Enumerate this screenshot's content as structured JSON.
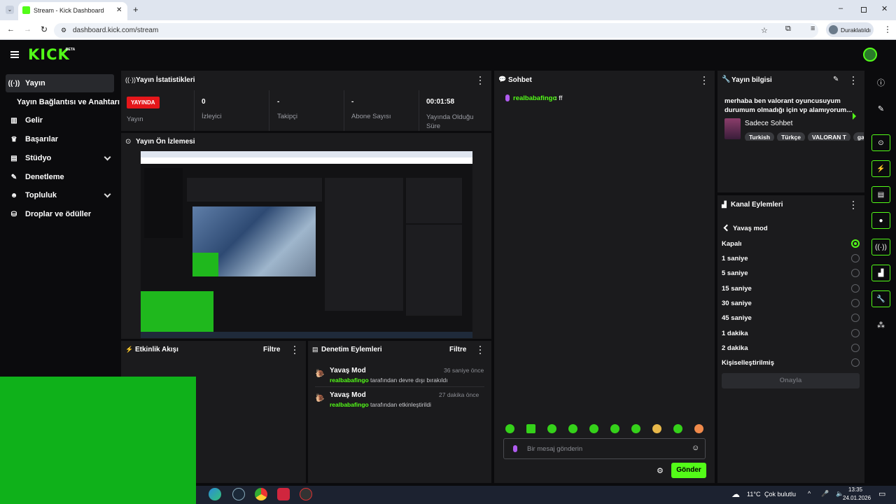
{
  "browser": {
    "tab_title": "Stream - Kick Dashboard",
    "url": "dashboard.kick.com/stream",
    "profile_label": "Duraklatıldı"
  },
  "header": {
    "logo": "KICK",
    "logo_badge": "BETA"
  },
  "sidebar": {
    "items": [
      {
        "label": "Yayın",
        "icon": "broadcast-icon"
      },
      {
        "label": "Yayın Bağlantısı ve Anahtarı"
      },
      {
        "label": "Gelir",
        "icon": "chart-icon"
      },
      {
        "label": "Başarılar",
        "icon": "trophy-icon"
      },
      {
        "label": "Stüdyo",
        "icon": "studio-icon"
      },
      {
        "label": "Denetleme",
        "icon": "wrench-icon"
      },
      {
        "label": "Topluluk",
        "icon": "users-icon"
      },
      {
        "label": "Droplar ve ödüller",
        "icon": "gift-icon"
      }
    ]
  },
  "stats": {
    "title": "Yayın İstatistikleri",
    "live_badge": "YAYINDA",
    "live_label": "Yayın",
    "viewers_value": "0",
    "viewers_label": "İzleyici",
    "followers_value": "-",
    "followers_label": "Takipçi",
    "subs_value": "-",
    "subs_label": "Abone Sayısı",
    "duration_value": "00:01:58",
    "duration_label": "Yayında Olduğu Süre"
  },
  "preview": {
    "title": "Yayın Ön İzlemesi"
  },
  "activity": {
    "title": "Etkinlik Akışı",
    "filter": "Filtre"
  },
  "moderation": {
    "title": "Denetim Eylemleri",
    "filter": "Filtre",
    "items": [
      {
        "title": "Yavaş Mod",
        "time": "36 saniye önce",
        "user": "realbabafingo",
        "text": "tarafından devre dışı bırakıldı"
      },
      {
        "title": "Yavaş Mod",
        "time": "27 dakika önce",
        "user": "realbabafingo",
        "text": "tarafından etkinleştirildi"
      }
    ]
  },
  "chat": {
    "title": "Sohbet",
    "messages": [
      {
        "user": "realbabafingo",
        "text": ": ff"
      }
    ],
    "input_placeholder": "Bir mesaj gönderin",
    "send_label": "Gönder"
  },
  "stream_info": {
    "title": "Yayın bilgisi",
    "stream_title": "merhaba ben valorant oyuncusuyum durumum olmadığı için vp alamıyorum...",
    "category": "Sadece Sohbet",
    "tags": [
      "Turkish",
      "Türkçe",
      "VALORAN T",
      "ga"
    ]
  },
  "channel_actions": {
    "title": "Kanal Eylemleri",
    "section": "Yavaş mod",
    "options": [
      "Kapalı",
      "1 saniye",
      "5 saniye",
      "15 saniye",
      "30 saniye",
      "45 saniye",
      "1 dakika",
      "2 dakika",
      "Kişiselleştirilmiş"
    ],
    "selected_index": 0,
    "confirm_label": "Onayla"
  },
  "taskbar": {
    "weather_temp": "11°C",
    "weather_text": "Çok bulutlu",
    "time": "13:35",
    "date": "24.01.2026"
  },
  "colors": {
    "brand": "#53fc18",
    "live": "#e5161a",
    "panel": "#1b1b1d"
  }
}
